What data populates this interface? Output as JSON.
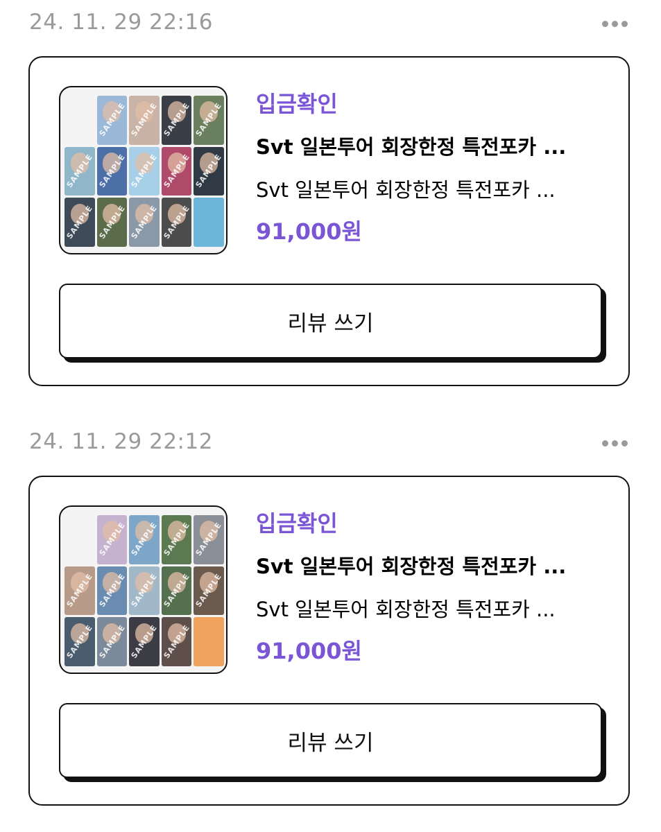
{
  "orders": [
    {
      "date": "24. 11. 29 22:16",
      "status": "입금확인",
      "title": "Svt 일본투어 회장한정 특전포카 ...",
      "subtitle": "Svt 일본투어 회장한정 특전포카 ...",
      "price": "91,000원",
      "review_label": "리뷰 쓰기",
      "thumbnail_watermark": "SAMPLE"
    },
    {
      "date": "24. 11. 29 22:12",
      "status": "입금확인",
      "title": "Svt 일본투어 회장한정 특전포카 ...",
      "subtitle": "Svt 일본투어 회장한정 특전포카 ...",
      "price": "91,000원",
      "review_label": "리뷰 쓰기",
      "thumbnail_watermark": "SAMPLE"
    }
  ],
  "colors": {
    "accent": "#7a56d6",
    "date_text": "#9a9a9a",
    "border": "#111111"
  },
  "icons": {
    "more": "more-horizontal-icon"
  }
}
